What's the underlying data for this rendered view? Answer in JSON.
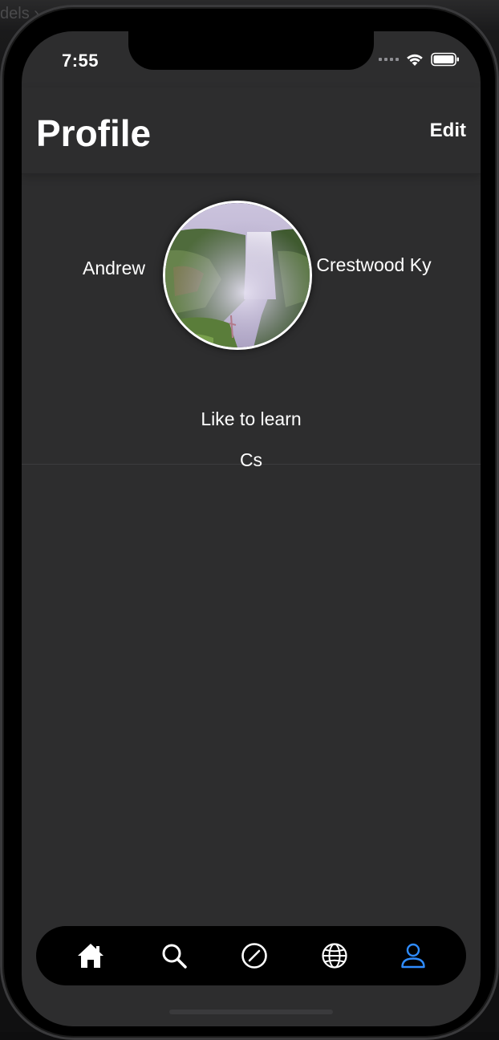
{
  "status_bar": {
    "time": "7:55"
  },
  "header": {
    "title": "Profile",
    "edit_label": "Edit"
  },
  "profile": {
    "first_name": "Andrew",
    "location": "Crestwood Ky",
    "bio_line_1": "Like to learn",
    "bio_line_2": "Cs",
    "avatar_image": "waterfall photo"
  },
  "tab_bar": {
    "items": [
      {
        "icon": "home-icon",
        "active": false
      },
      {
        "icon": "search-icon",
        "active": false
      },
      {
        "icon": "compass-icon",
        "active": false
      },
      {
        "icon": "globe-icon",
        "active": false
      },
      {
        "icon": "person-icon",
        "active": true
      }
    ],
    "active_color": "#2f8cff",
    "inactive_color": "#ffffff"
  }
}
